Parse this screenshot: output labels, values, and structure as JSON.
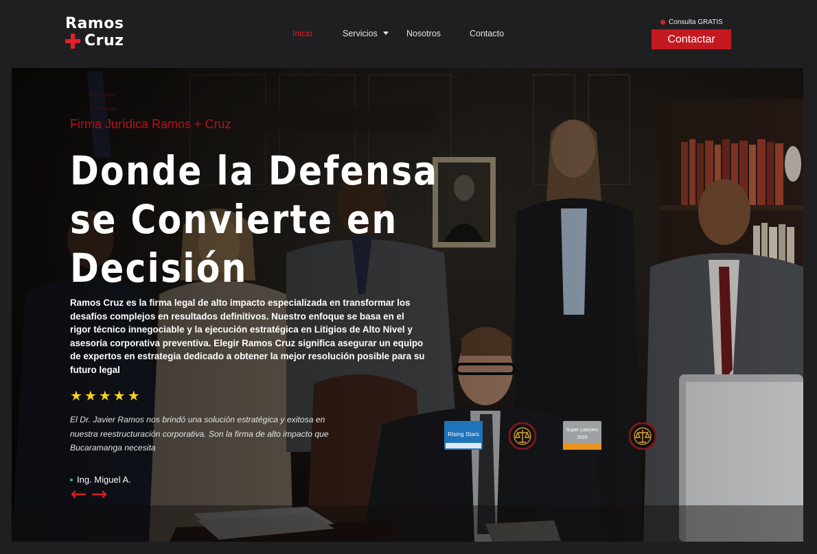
{
  "header": {
    "logo_line1": "Ramos",
    "logo_line2": "Cruz",
    "nav": [
      "Inicio",
      "Servicios",
      "Nosotros",
      "Contacto"
    ],
    "consulta_label": "Consulta GRATIS",
    "contact_button": "Contactar"
  },
  "hero": {
    "eyebrow": "Firma Jurídica Ramos + Cruz",
    "headline": [
      "Donde la Defensa",
      "se Convierte en",
      "Decisión"
    ],
    "intro": "Ramos Cruz es la firma legal de alto impacto especializada en transformar los desafíos complejos en resultados definitivos. Nuestro enfoque se basa en el rigor técnico innegociable y la ejecución estratégica en Litigios de Alto Nivel y asesoría corporativa preventiva. Elegir Ramos Cruz significa asegurar un equipo de expertos en estrategia dedicado a obtener la mejor resolución posible para su futuro legal",
    "rating": 5,
    "stars": "★★★★★",
    "testimonial": "El Dr. Javier Ramos nos brindó una solución estratégica y exitosa en nuestra reestructuración corporativa. Son la firma de alto impacto que Bucaramanga necesita",
    "author": "Ing. Miguel  A."
  },
  "badges": {
    "rising_stars": "Rising Stars",
    "super_lawyers_title": "Super Lawyers",
    "super_lawyers_year": "2020"
  },
  "colors": {
    "brand_red": "#d61f26",
    "button_red": "#c31a22",
    "star_yellow": "#f7d21b",
    "background": "#1f1f21"
  },
  "icons": [
    "plus-logo-icon",
    "chevron-down-icon",
    "dot-icon",
    "star-icon",
    "arrow-left-icon",
    "arrow-right-icon",
    "scales-of-justice-icon"
  ]
}
